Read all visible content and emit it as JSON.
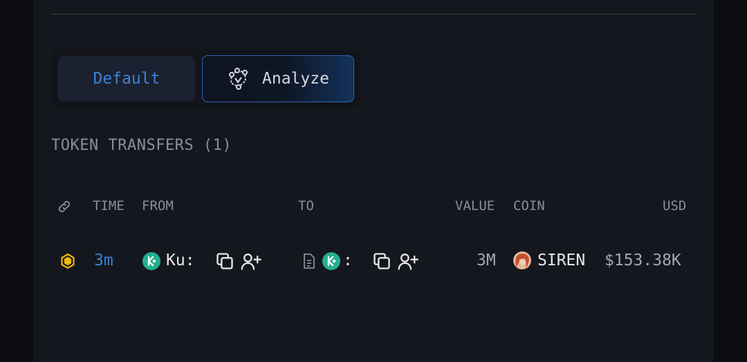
{
  "toggle": {
    "default_label": "Default",
    "analyze_label": "Analyze"
  },
  "section": {
    "title": "TOKEN TRANSFERS (1)"
  },
  "table": {
    "headers": {
      "time": "TIME",
      "from": "FROM",
      "to": "TO",
      "value": "VALUE",
      "coin": "COIN",
      "usd": "USD"
    },
    "rows": [
      {
        "time": "3m",
        "from_name": "Ku:",
        "to_name": ":",
        "value": "3M",
        "coin": "SIREN",
        "usd": "$153.38K"
      }
    ]
  },
  "colors": {
    "accent_blue": "#3b82d6",
    "kucoin_green": "#23af91",
    "bnb_yellow": "#f0b90b"
  },
  "icons": [
    "link-icon",
    "analyze-network-icon",
    "bnb-chain-icon",
    "kucoin-logo-icon",
    "copy-icon",
    "add-user-icon",
    "contract-file-icon",
    "siren-coin-icon"
  ]
}
